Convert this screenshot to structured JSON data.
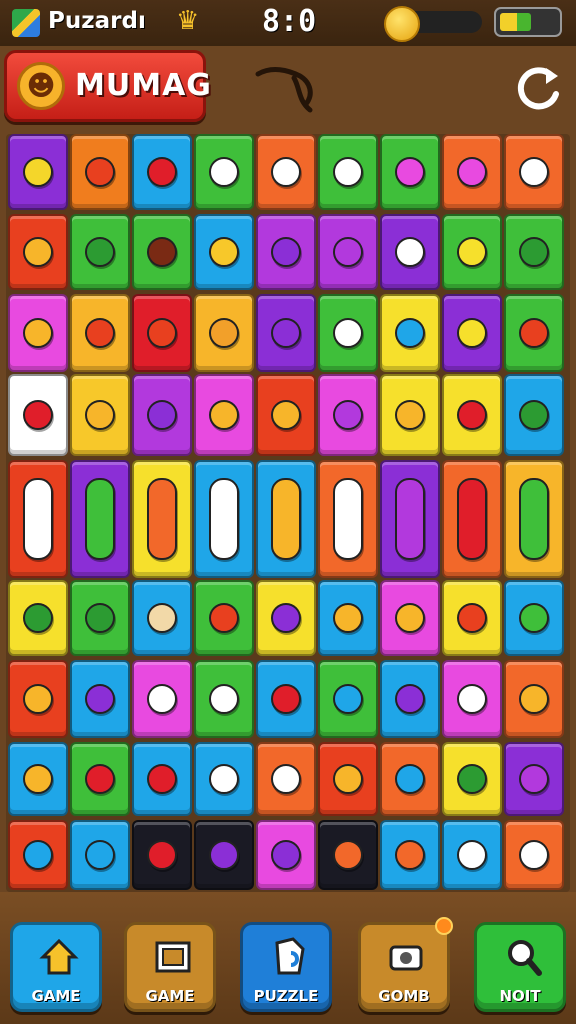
{
  "status_bar": {
    "app_name": "Puzardı",
    "clock": "8:0",
    "battery_level": 0.55
  },
  "header": {
    "title": "MUMAG",
    "icons": [
      "smiley-face-icon",
      "refresh-icon"
    ]
  },
  "board": {
    "rows": 9,
    "cols": 9,
    "tile_colors": [
      [
        "#8b2fd6",
        "#f07d1e",
        "#1fa6e8",
        "#3fbf3a",
        "#f2682a",
        "#3fbf3a",
        "#3fbf3a",
        "#f2682a",
        "#f2682a"
      ],
      [
        "#e8401f",
        "#3fbf3a",
        "#3fbf3a",
        "#1fa6e8",
        "#b239dd",
        "#b239dd",
        "#8b2fd6",
        "#3fbf3a",
        "#3fbf3a"
      ],
      [
        "#e84ae0",
        "#f7b52a",
        "#e01e2a",
        "#f7b52a",
        "#8b2fd6",
        "#3fbf3a",
        "#f6e02c",
        "#8b2fd6",
        "#3fbf3a"
      ],
      [
        "#ffffff",
        "#f7c82a",
        "#b239dd",
        "#e84ae0",
        "#e8401f",
        "#e84ae0",
        "#f6e02c",
        "#f6e02c",
        "#1fa6e8"
      ],
      [
        "#e8401f",
        "#8b2fd6",
        "#f6e02c",
        "#1fa6e8",
        "#1fa6e8",
        "#f2682a",
        "#8b2fd6",
        "#f2682a",
        "#f7b52a"
      ],
      [
        "#f6e02c",
        "#3fbf3a",
        "#1fa6e8",
        "#3fbf3a",
        "#f6e02c",
        "#1fa6e8",
        "#e84ae0",
        "#f6e02c",
        "#1fa6e8"
      ],
      [
        "#e8401f",
        "#1fa6e8",
        "#e84ae0",
        "#3fbf3a",
        "#1fa6e8",
        "#3fbf3a",
        "#1fa6e8",
        "#e84ae0",
        "#f2682a"
      ],
      [
        "#1fa6e8",
        "#3fbf3a",
        "#1fa6e8",
        "#1fa6e8",
        "#f2682a",
        "#e8401f",
        "#f2682a",
        "#f6e02c",
        "#8b2fd6"
      ],
      [
        "#e8401f",
        "#1fa6e8",
        "#1a1a24",
        "#1a1a24",
        "#e84ae0",
        "#1a1a24",
        "#1fa6e8",
        "#1fa6e8",
        "#f2682a"
      ]
    ],
    "glyph_colors": [
      [
        "#f4d62a",
        "#e8401f",
        "#e01e2a",
        "#ffffff",
        "#ffffff",
        "#ffffff",
        "#e84ae0",
        "#e84ae0",
        "#ffffff"
      ],
      [
        "#f7b52a",
        "#2c9b32",
        "#7a2a14",
        "#f7c82a",
        "#8b2fd6",
        "#b239dd",
        "#ffffff",
        "#f6e02c",
        "#2c9b32"
      ],
      [
        "#f7b52a",
        "#e8401f",
        "#e8401f",
        "#f2a02a",
        "#8b2fd6",
        "#ffffff",
        "#1fa6e8",
        "#f6e02c",
        "#e8401f"
      ],
      [
        "#e01e2a",
        "#f7b52a",
        "#8b2fd6",
        "#f7b52a",
        "#f7b52a",
        "#b239dd",
        "#f7b52a",
        "#e01e2a",
        "#2c9b32"
      ],
      [
        "#ffffff",
        "#3fbf3a",
        "#f2682a",
        "#ffffff",
        "#f7b52a",
        "#ffffff",
        "#b239dd",
        "#e01e2a",
        "#3fbf3a"
      ],
      [
        "#2c9b32",
        "#2c9b32",
        "#f2d9a8",
        "#e8401f",
        "#8b2fd6",
        "#f7b52a",
        "#f7b52a",
        "#e8401f",
        "#3fbf3a"
      ],
      [
        "#f7b52a",
        "#8b2fd6",
        "#ffffff",
        "#ffffff",
        "#e01e2a",
        "#1fa6e8",
        "#8b2fd6",
        "#ffffff",
        "#f7b52a"
      ],
      [
        "#f7b52a",
        "#e01e2a",
        "#e01e2a",
        "#ffffff",
        "#ffffff",
        "#f7b52a",
        "#1fa6e8",
        "#2c9b32",
        "#b239dd"
      ],
      [
        "#1fa6e8",
        "#1fa6e8",
        "#e01e2a",
        "#8b2fd6",
        "#8b2fd6",
        "#f2682a",
        "#f2682a",
        "#ffffff",
        "#ffffff"
      ]
    ]
  },
  "bottom_nav": [
    {
      "label": "GAME",
      "icon": "home-icon",
      "color": "#1fa6e8"
    },
    {
      "label": "GAME",
      "icon": "frame-icon",
      "color": "#c88a2a"
    },
    {
      "label": "PUZZLE",
      "icon": "puzzle-icon",
      "color": "#1f7fd8"
    },
    {
      "label": "GOMB",
      "icon": "camera-icon",
      "color": "#c88a2a"
    },
    {
      "label": "NOIT",
      "icon": "search-icon",
      "color": "#2fbf3a"
    }
  ]
}
